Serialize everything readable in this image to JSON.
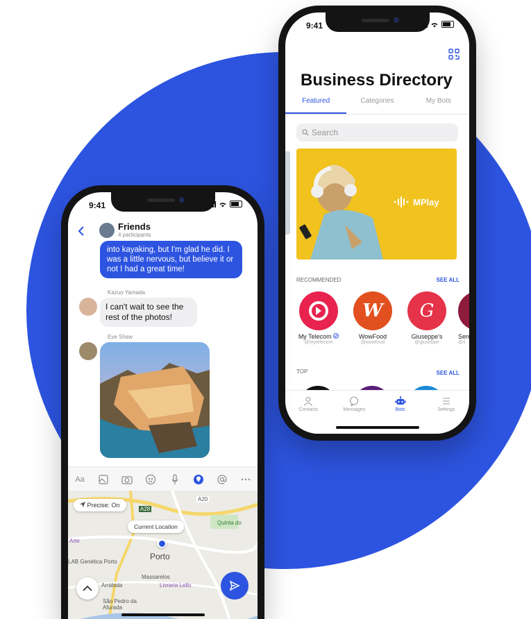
{
  "colors": {
    "accent": "#2d54e0",
    "background_circle": "#2d54e0"
  },
  "phone_right": {
    "status_time": "9:41",
    "qr_icon": "qr-code-icon",
    "title": "Business Directory",
    "tabs": [
      {
        "label": "Featured",
        "active": true
      },
      {
        "label": "Categories",
        "active": false
      },
      {
        "label": "My Bots",
        "active": false
      }
    ],
    "search_placeholder": "Search",
    "banner": {
      "brand": "MPlay"
    },
    "recommended": {
      "label": "RECOMMENDED",
      "see_all": "SEE ALL",
      "bots": [
        {
          "name": "My Telecom",
          "handle": "@mytelecom",
          "color": "#e8234e",
          "glyph": "D",
          "verified": true
        },
        {
          "name": "WowFood",
          "handle": "@wowfood",
          "color": "#e2501f",
          "glyph": "W"
        },
        {
          "name": "Giuseppe's",
          "handle": "@giuseppe",
          "color": "#e53349",
          "glyph": "G"
        },
        {
          "name": "Sere",
          "handle": "@s",
          "color": "#8e1a3c",
          "glyph": ""
        }
      ]
    },
    "top": {
      "label": "TOP",
      "see_all": "SEE ALL"
    },
    "tabbar": [
      {
        "label": "Contacts",
        "icon": "person-icon",
        "active": false
      },
      {
        "label": "Messages",
        "icon": "chat-bubble-icon",
        "active": false
      },
      {
        "label": "Bots",
        "icon": "bot-icon",
        "active": true
      },
      {
        "label": "Settings",
        "icon": "menu-icon",
        "active": false
      }
    ]
  },
  "phone_left": {
    "status_time": "9:41",
    "chat": {
      "title": "Friends",
      "subtitle": "4 participants",
      "outgoing_message": "into kayaking, but I'm glad he did. I was a little nervous, but believe it or not I had a great time!",
      "messages": [
        {
          "sender": "Kazuo Yamada",
          "text": "I can't wait to see the rest of the photos!"
        },
        {
          "sender": "Eve Shaw",
          "type": "photo"
        }
      ]
    },
    "composer_icons": [
      "text-format-icon",
      "image-icon",
      "camera-icon",
      "sticker-icon",
      "microphone-icon",
      "location-icon",
      "mention-icon",
      "more-icon"
    ],
    "composer_text_icon": "Aa",
    "map": {
      "precise_label": "Precise: On",
      "current_location": "Current Location",
      "city": "Porto",
      "labels": [
        "Quinta do",
        "Arte",
        "LAB Genética Porto",
        "Massarelos",
        "Arrábida",
        "Livraria Lello",
        "São Pedro da Afurada",
        "A20",
        "A28"
      ]
    }
  }
}
